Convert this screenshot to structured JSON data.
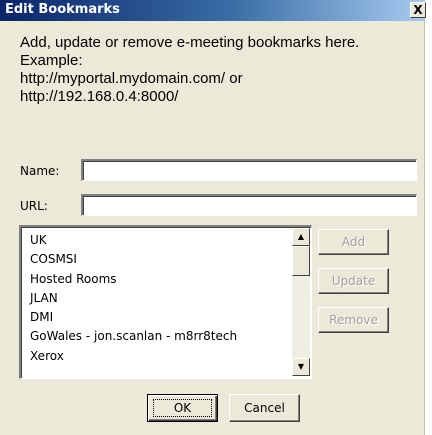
{
  "window": {
    "title": "Edit Bookmarks",
    "close_glyph": "X"
  },
  "description": {
    "lines": [
      "Add, update or remove e-meeting bookmarks here.",
      "Example:",
      "http://myportal.mydomain.com/ or",
      "http://192.168.0.4:8000/"
    ]
  },
  "form": {
    "name_label": "Name:",
    "name_value": "",
    "url_label": "URL:",
    "url_value": ""
  },
  "bookmarks": {
    "items": [
      "UK",
      "COSMSI",
      "Hosted Rooms",
      "JLAN",
      "DMI",
      "GoWales - jon.scanlan - m8rr8tech",
      "Xerox"
    ]
  },
  "buttons": {
    "add": "Add",
    "update": "Update",
    "remove": "Remove",
    "ok": "OK",
    "cancel": "Cancel"
  },
  "colors": {
    "dialog_bg": "#ece9d8",
    "titlebar_start": "#0a246a",
    "titlebar_end": "#a6caf0",
    "disabled_text": "#a0a0a0"
  },
  "icons": {
    "scroll_up": "up-arrow-icon",
    "scroll_down": "down-arrow-icon",
    "close": "close-icon"
  }
}
